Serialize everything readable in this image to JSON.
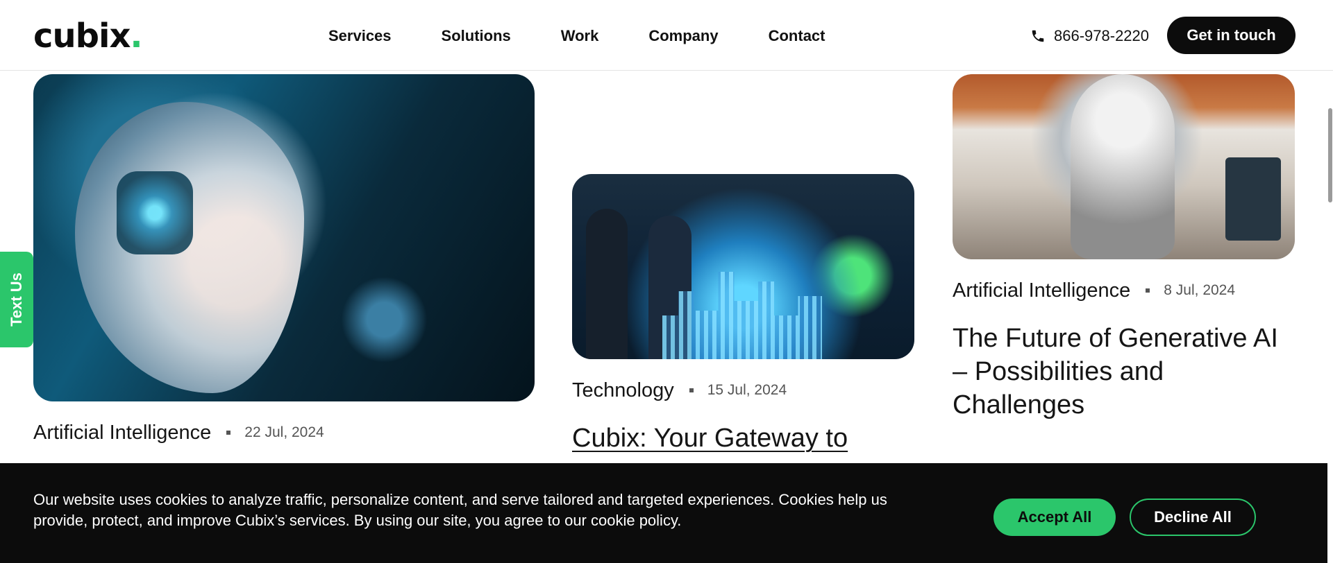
{
  "header": {
    "logo_text": "cubix",
    "logo_dot": ".",
    "nav": [
      "Services",
      "Solutions",
      "Work",
      "Company",
      "Contact"
    ],
    "phone": "866-978-2220",
    "cta_label": "Get in touch"
  },
  "side_tab": {
    "label": "Text Us"
  },
  "cards": [
    {
      "category": "Artificial Intelligence",
      "date": "22 Jul, 2024",
      "title": ""
    },
    {
      "category": "Technology",
      "date": "15 Jul, 2024",
      "title": "Cubix: Your Gateway to"
    },
    {
      "category": "Artificial Intelligence",
      "date": "8 Jul, 2024",
      "title": "The Future of Generative AI – Possibilities and Challenges"
    }
  ],
  "cookie": {
    "text": "Our website uses cookies to analyze traffic, personalize content, and serve tailored and targeted experiences. Cookies help us provide, protect, and improve Cubix’s services. By using our site, you agree to our cookie policy.",
    "accept_label": "Accept All",
    "decline_label": "Decline All"
  },
  "colors": {
    "brand_green": "#2bc66b",
    "dark": "#0c0c0c"
  },
  "icons": {
    "phone": "phone-icon"
  }
}
